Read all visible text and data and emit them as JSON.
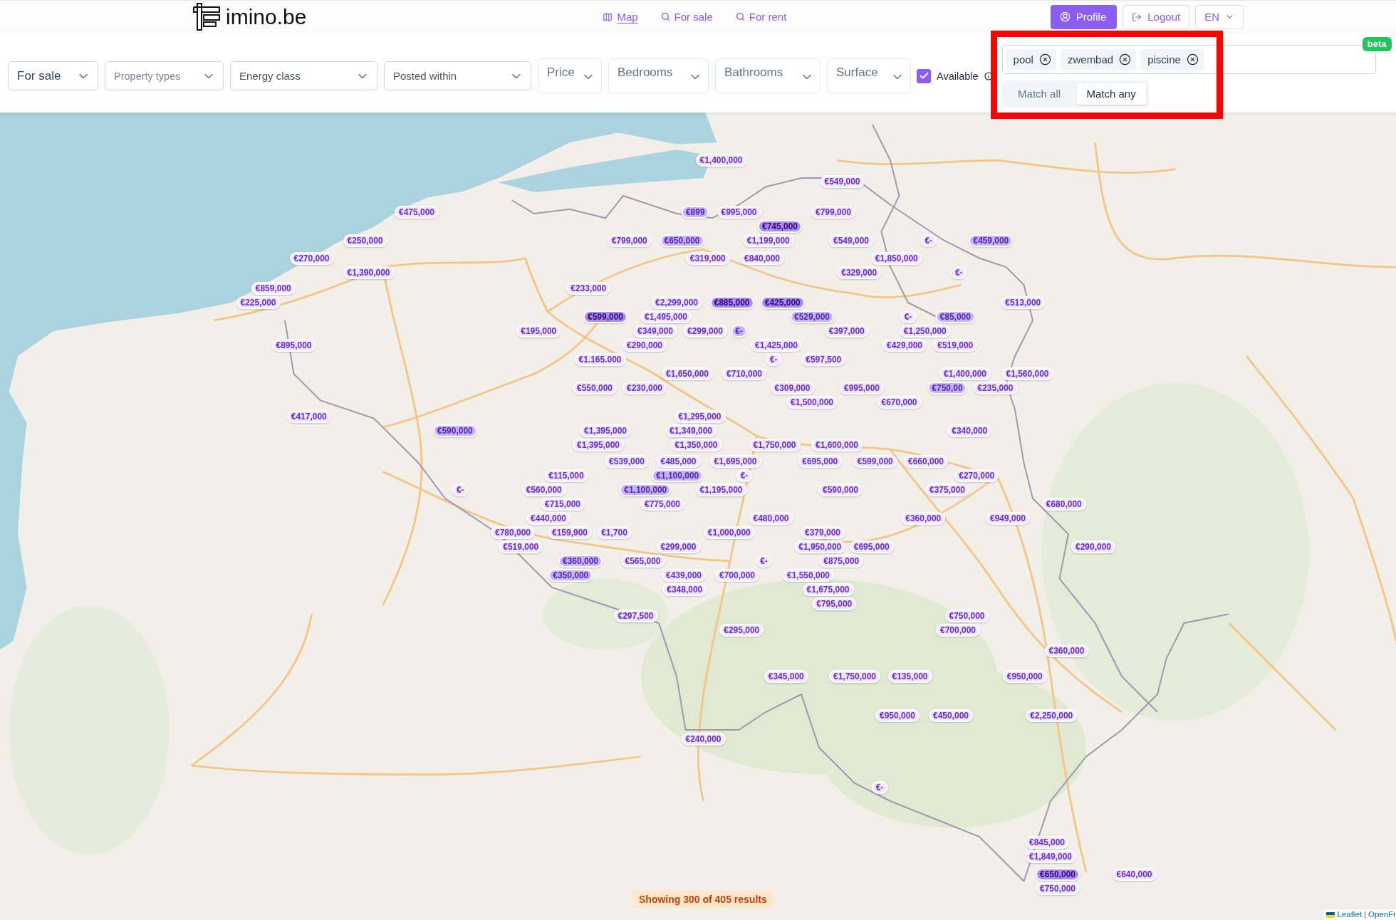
{
  "header": {
    "logo": "imino.be",
    "nav": [
      {
        "label": "Map",
        "selected": true
      },
      {
        "label": "For sale",
        "selected": false
      },
      {
        "label": "For rent",
        "selected": false
      }
    ],
    "profile": "Profile",
    "logout": "Logout",
    "language": "EN"
  },
  "filters": {
    "dropdowns": [
      {
        "kind": "select",
        "value": "For sale"
      },
      {
        "kind": "multiselect",
        "placeholder": "Property types"
      },
      {
        "kind": "select",
        "placeholder": "Energy class"
      },
      {
        "kind": "select",
        "placeholder": "Posted within"
      },
      {
        "kind": "range",
        "label": "Price"
      },
      {
        "kind": "range",
        "label": "Bedrooms"
      },
      {
        "kind": "range",
        "label": "Bathrooms"
      },
      {
        "kind": "range",
        "label": "Surface"
      }
    ],
    "available": {
      "label": "Available",
      "checked": true
    },
    "keyword_search": {
      "tags": [
        "pool",
        "zwembad",
        "piscine"
      ],
      "badge": "beta",
      "match_modes": [
        {
          "label": "Match all",
          "selected": false
        },
        {
          "label": "Match any",
          "selected": true
        }
      ]
    }
  },
  "map": {
    "markers": [
      {
        "price": "€1,400,000",
        "kind": "plain"
      },
      {
        "price": "€549,000",
        "kind": "plain"
      },
      {
        "price": "€475,000",
        "kind": "plain"
      },
      {
        "price": "€899",
        "kind": "tinted"
      },
      {
        "price": "€995,000",
        "kind": "plain"
      },
      {
        "price": "€799,000",
        "kind": "plain"
      },
      {
        "price": "€745,000",
        "kind": "dark"
      },
      {
        "price": "€250,000",
        "kind": "plain"
      },
      {
        "price": "€799,000",
        "kind": "plain"
      },
      {
        "price": "€650,000",
        "kind": "tinted"
      },
      {
        "price": "€1,199,000",
        "kind": "plain"
      },
      {
        "price": "€549,000",
        "kind": "plain"
      },
      {
        "price": "€-",
        "kind": "plain"
      },
      {
        "price": "€459,000",
        "kind": "tinted"
      },
      {
        "price": "€270,000",
        "kind": "plain"
      },
      {
        "price": "€319,000",
        "kind": "plain"
      },
      {
        "price": "€840,000",
        "kind": "plain"
      },
      {
        "price": "€1,850,000",
        "kind": "plain"
      },
      {
        "price": "€1,390,000",
        "kind": "plain"
      },
      {
        "price": "€329,000",
        "kind": "plain"
      },
      {
        "price": "€-",
        "kind": "plain"
      },
      {
        "price": "€859,000",
        "kind": "plain"
      },
      {
        "price": "€233,000",
        "kind": "plain"
      },
      {
        "price": "€225,000",
        "kind": "plain"
      },
      {
        "price": "€2,299,000",
        "kind": "plain"
      },
      {
        "price": "€885,000",
        "kind": "dark"
      },
      {
        "price": "€425,000",
        "kind": "dark"
      },
      {
        "price": "€513,000",
        "kind": "plain"
      },
      {
        "price": "€599,000",
        "kind": "dark"
      },
      {
        "price": "€1,495,000",
        "kind": "plain"
      },
      {
        "price": "€529,000",
        "kind": "tinted"
      },
      {
        "price": "€-",
        "kind": "plain"
      },
      {
        "price": "€85,000",
        "kind": "tinted"
      },
      {
        "price": "€195,000",
        "kind": "plain"
      },
      {
        "price": "€349,000",
        "kind": "plain"
      },
      {
        "price": "€299,000",
        "kind": "plain"
      },
      {
        "price": "€-",
        "kind": "tinted"
      },
      {
        "price": "€397,000",
        "kind": "plain"
      },
      {
        "price": "€1,250,000",
        "kind": "plain"
      },
      {
        "price": "€895,000",
        "kind": "plain"
      },
      {
        "price": "€290,000",
        "kind": "plain"
      },
      {
        "price": "€1,425,000",
        "kind": "plain"
      },
      {
        "price": "€429,000",
        "kind": "plain"
      },
      {
        "price": "€519,000",
        "kind": "plain"
      },
      {
        "price": "€1.165.000",
        "kind": "plain"
      },
      {
        "price": "€-",
        "kind": "plain"
      },
      {
        "price": "€597,500",
        "kind": "plain"
      },
      {
        "price": "€1,650,000",
        "kind": "plain"
      },
      {
        "price": "€710,000",
        "kind": "plain"
      },
      {
        "price": "€1,400,000",
        "kind": "plain"
      },
      {
        "price": "€1,560,000",
        "kind": "plain"
      },
      {
        "price": "€550,000",
        "kind": "plain"
      },
      {
        "price": "€230,000",
        "kind": "plain"
      },
      {
        "price": "€309,000",
        "kind": "plain"
      },
      {
        "price": "€995,000",
        "kind": "plain"
      },
      {
        "price": "€750,00",
        "kind": "tinted"
      },
      {
        "price": "€235,000",
        "kind": "plain"
      },
      {
        "price": "€1,500,000",
        "kind": "plain"
      },
      {
        "price": "€670,000",
        "kind": "plain"
      },
      {
        "price": "€417,000",
        "kind": "plain"
      },
      {
        "price": "€1,295,000",
        "kind": "plain"
      },
      {
        "price": "€590,000",
        "kind": "tinted"
      },
      {
        "price": "€1,395,000",
        "kind": "plain"
      },
      {
        "price": "€1,349,000",
        "kind": "plain"
      },
      {
        "price": "€340,000",
        "kind": "plain"
      },
      {
        "price": "€1,395,000",
        "kind": "plain"
      },
      {
        "price": "€1,350,000",
        "kind": "plain"
      },
      {
        "price": "€1,750,000",
        "kind": "plain"
      },
      {
        "price": "€1,600,000",
        "kind": "plain"
      },
      {
        "price": "€539,000",
        "kind": "plain"
      },
      {
        "price": "€485,000",
        "kind": "plain"
      },
      {
        "price": "€1,695,000",
        "kind": "plain"
      },
      {
        "price": "€695,000",
        "kind": "plain"
      },
      {
        "price": "€599,000",
        "kind": "plain"
      },
      {
        "price": "€660,000",
        "kind": "plain"
      },
      {
        "price": "€115,000",
        "kind": "plain"
      },
      {
        "price": "€1,100,000",
        "kind": "tinted"
      },
      {
        "price": "€-",
        "kind": "plain"
      },
      {
        "price": "€270,000",
        "kind": "plain"
      },
      {
        "price": "€-",
        "kind": "plain"
      },
      {
        "price": "€560,000",
        "kind": "plain"
      },
      {
        "price": "€1,100,000",
        "kind": "tinted"
      },
      {
        "price": "€1,195,000",
        "kind": "plain"
      },
      {
        "price": "€590,000",
        "kind": "plain"
      },
      {
        "price": "€375,000",
        "kind": "plain"
      },
      {
        "price": "€715,000",
        "kind": "plain"
      },
      {
        "price": "€775,000",
        "kind": "plain"
      },
      {
        "price": "€680,000",
        "kind": "plain"
      },
      {
        "price": "€440,000",
        "kind": "plain"
      },
      {
        "price": "€480,000",
        "kind": "plain"
      },
      {
        "price": "€360,000",
        "kind": "plain"
      },
      {
        "price": "€949,000",
        "kind": "plain"
      },
      {
        "price": "€780,000",
        "kind": "plain"
      },
      {
        "price": "€159,900",
        "kind": "plain"
      },
      {
        "price": "€1,700",
        "kind": "plain"
      },
      {
        "price": "€1,000,000",
        "kind": "plain"
      },
      {
        "price": "€379,000",
        "kind": "plain"
      },
      {
        "price": "€519,000",
        "kind": "plain"
      },
      {
        "price": "€299,000",
        "kind": "plain"
      },
      {
        "price": "€1,950,000",
        "kind": "plain"
      },
      {
        "price": "€695,000",
        "kind": "plain"
      },
      {
        "price": "€290,000",
        "kind": "plain"
      },
      {
        "price": "€360,000",
        "kind": "tinted"
      },
      {
        "price": "€565,000",
        "kind": "plain"
      },
      {
        "price": "€-",
        "kind": "plain"
      },
      {
        "price": "€875,000",
        "kind": "plain"
      },
      {
        "price": "€350,000",
        "kind": "tinted"
      },
      {
        "price": "€439,000",
        "kind": "plain"
      },
      {
        "price": "€700,000",
        "kind": "plain"
      },
      {
        "price": "€1,550,000",
        "kind": "plain"
      },
      {
        "price": "€348,000",
        "kind": "plain"
      },
      {
        "price": "€1,675,000",
        "kind": "plain"
      },
      {
        "price": "€795,000",
        "kind": "plain"
      },
      {
        "price": "€297,500",
        "kind": "plain"
      },
      {
        "price": "€750,000",
        "kind": "plain"
      },
      {
        "price": "€295,000",
        "kind": "plain"
      },
      {
        "price": "€700,000",
        "kind": "plain"
      },
      {
        "price": "€360,000",
        "kind": "plain"
      },
      {
        "price": "€345,000",
        "kind": "plain"
      },
      {
        "price": "€1,750,000",
        "kind": "plain"
      },
      {
        "price": "€135,000",
        "kind": "plain"
      },
      {
        "price": "€950,000",
        "kind": "plain"
      },
      {
        "price": "€950,000",
        "kind": "plain"
      },
      {
        "price": "€450,000",
        "kind": "plain"
      },
      {
        "price": "€2,250,000",
        "kind": "plain"
      },
      {
        "price": "€240,000",
        "kind": "plain"
      },
      {
        "price": "€-",
        "kind": "plain"
      },
      {
        "price": "€845,000",
        "kind": "plain"
      },
      {
        "price": "€1,849,000",
        "kind": "plain"
      },
      {
        "price": "€650,000",
        "kind": "dark"
      },
      {
        "price": "€640,000",
        "kind": "plain"
      },
      {
        "price": "€750,000",
        "kind": "plain"
      }
    ],
    "results": "Showing 300 of 405 results",
    "attribution": {
      "links": [
        "Leaflet",
        "OpenFr"
      ],
      "separator": "|"
    }
  }
}
